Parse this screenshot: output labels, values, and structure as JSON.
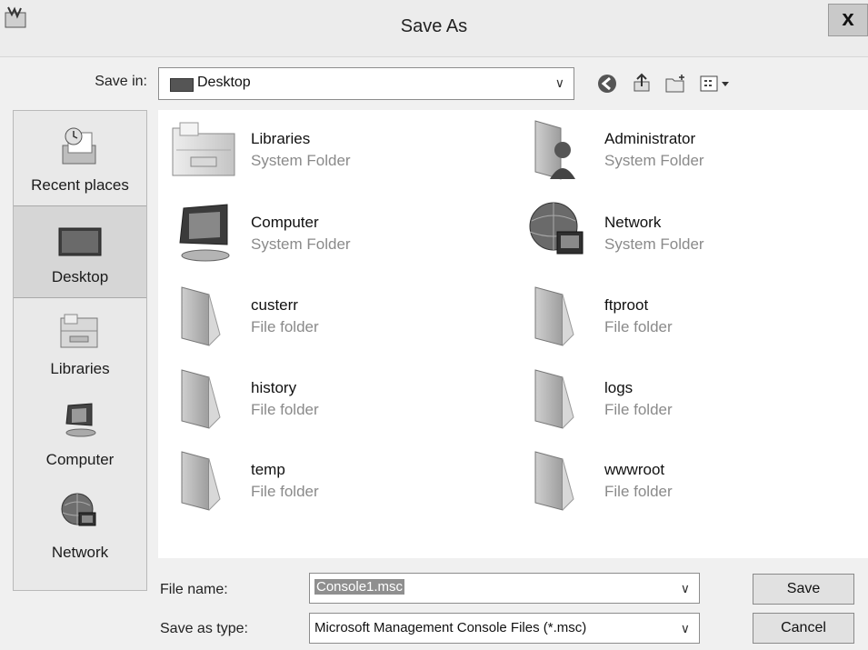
{
  "window": {
    "title": "Save As",
    "close_label": "x"
  },
  "save_in": {
    "label": "Save in:",
    "value": "Desktop"
  },
  "toolbar": {
    "icons": [
      "back-icon",
      "up-folder-icon",
      "new-folder-icon",
      "view-menu-icon"
    ]
  },
  "places": [
    {
      "label": "Recent places",
      "icon": "recent-places-icon"
    },
    {
      "label": "Desktop",
      "icon": "desktop-icon",
      "selected": true
    },
    {
      "label": "Libraries",
      "icon": "libraries-icon"
    },
    {
      "label": "Computer",
      "icon": "computer-icon"
    },
    {
      "label": "Network",
      "icon": "network-icon"
    }
  ],
  "files": [
    {
      "name": "Libraries",
      "type": "System Folder",
      "icon": "libraries-folder-icon"
    },
    {
      "name": "Administrator",
      "type": "System Folder",
      "icon": "user-folder-icon"
    },
    {
      "name": "Computer",
      "type": "System Folder",
      "icon": "computer-icon"
    },
    {
      "name": "Network",
      "type": "System Folder",
      "icon": "network-icon"
    },
    {
      "name": "custerr",
      "type": "File folder",
      "icon": "folder-icon"
    },
    {
      "name": "ftproot",
      "type": "File folder",
      "icon": "folder-icon"
    },
    {
      "name": "history",
      "type": "File folder",
      "icon": "folder-icon"
    },
    {
      "name": "logs",
      "type": "File folder",
      "icon": "folder-icon"
    },
    {
      "name": "temp",
      "type": "File folder",
      "icon": "folder-icon"
    },
    {
      "name": "wwwroot",
      "type": "File folder",
      "icon": "folder-icon"
    }
  ],
  "file_name": {
    "label": "File name:",
    "value": "Console1.msc"
  },
  "save_as_type": {
    "label": "Save as type:",
    "value": "Microsoft Management Console Files (*.msc)"
  },
  "buttons": {
    "save": "Save",
    "cancel": "Cancel"
  },
  "colors": {
    "selection": "#d6d6d6",
    "file_type_text": "#8a8a8a"
  }
}
